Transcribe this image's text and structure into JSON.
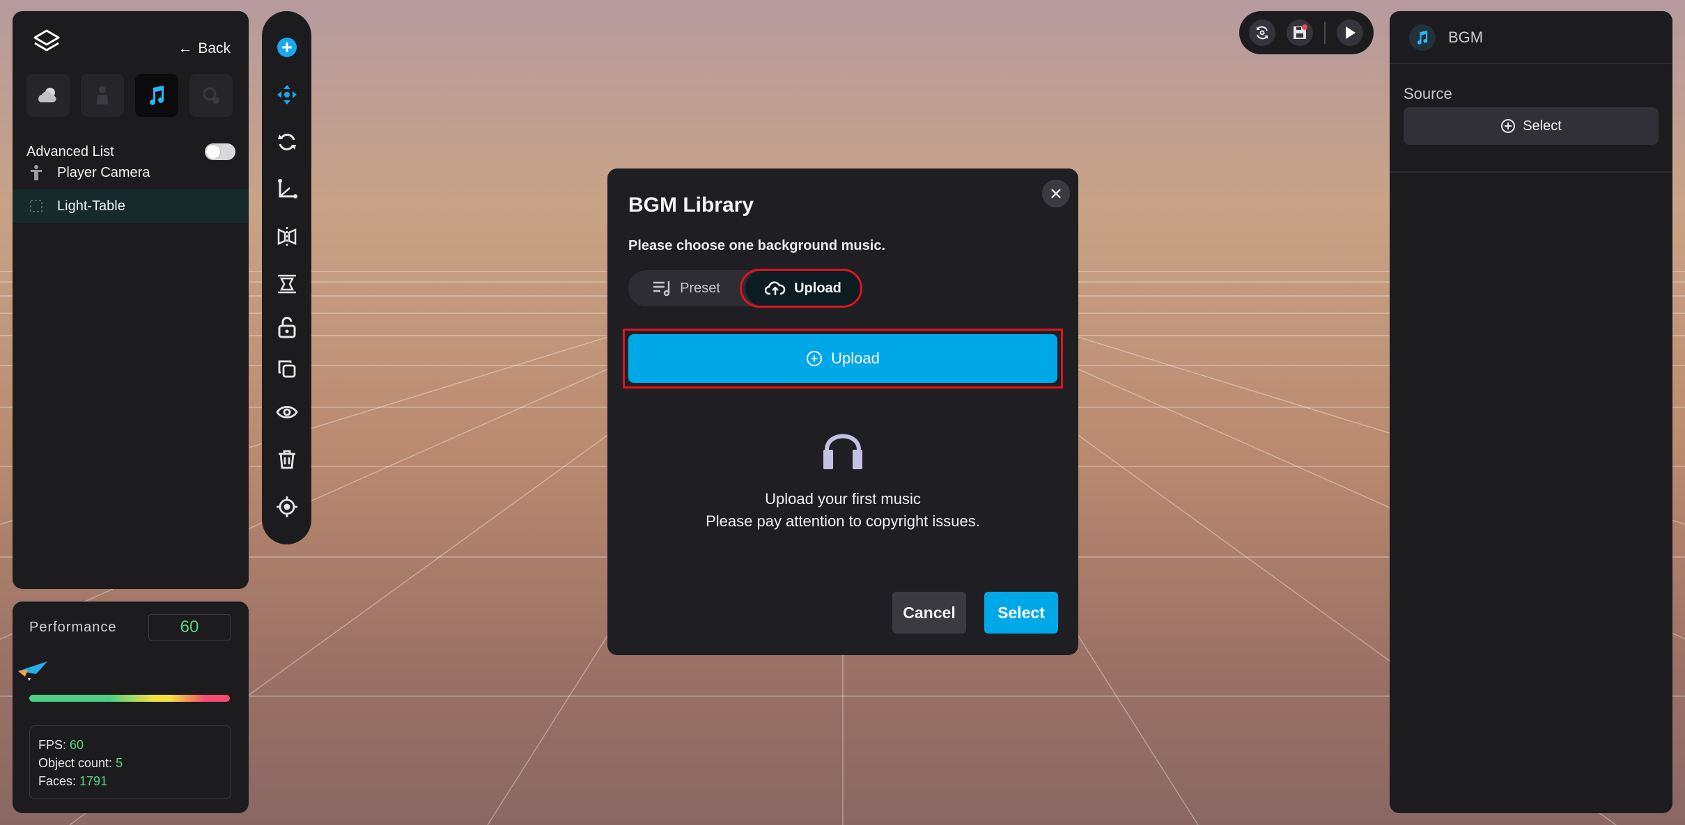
{
  "left_panel": {
    "back_label": "Back",
    "asset_tabs": [
      {
        "icon": "weather-icon",
        "active": false
      },
      {
        "icon": "character-icon",
        "active": false
      },
      {
        "icon": "music-note-icon",
        "active": true
      },
      {
        "icon": "effects-icon",
        "active": false
      }
    ],
    "advanced_list_label": "Advanced List",
    "tree": [
      {
        "label": "Player Camera",
        "icon": "person-icon",
        "selected": false
      },
      {
        "label": "Light-Table",
        "icon": "dotted-box-icon",
        "selected": true
      }
    ]
  },
  "performance": {
    "title": "Performance",
    "value": "60",
    "fps_label": "FPS: ",
    "fps_value": "60",
    "object_count_label": "Object count: ",
    "object_count_value": "5",
    "faces_label": "Faces: ",
    "faces_value": "1791"
  },
  "toolbar": {
    "tools": [
      "add-icon",
      "move-icon",
      "rotate-icon",
      "axis-icon",
      "mirror-icon",
      "align-icon",
      "unlock-icon",
      "duplicate-icon",
      "visibility-icon",
      "trash-icon",
      "focus-icon"
    ]
  },
  "right_panel": {
    "title": "BGM",
    "source_label": "Source",
    "select_label": "Select"
  },
  "modal": {
    "title": "BGM Library",
    "subtitle": "Please choose one background music.",
    "tab_preset": "Preset",
    "tab_upload": "Upload",
    "upload_button": "Upload",
    "empty_line1": "Upload your first music",
    "empty_line2": "Please pay attention to copyright issues.",
    "cancel_label": "Cancel",
    "select_label": "Select"
  },
  "colors": {
    "accent": "#00a8e8",
    "highlight": "#e0141e",
    "success": "#5fd07e",
    "panel": "#1c1c1f"
  }
}
